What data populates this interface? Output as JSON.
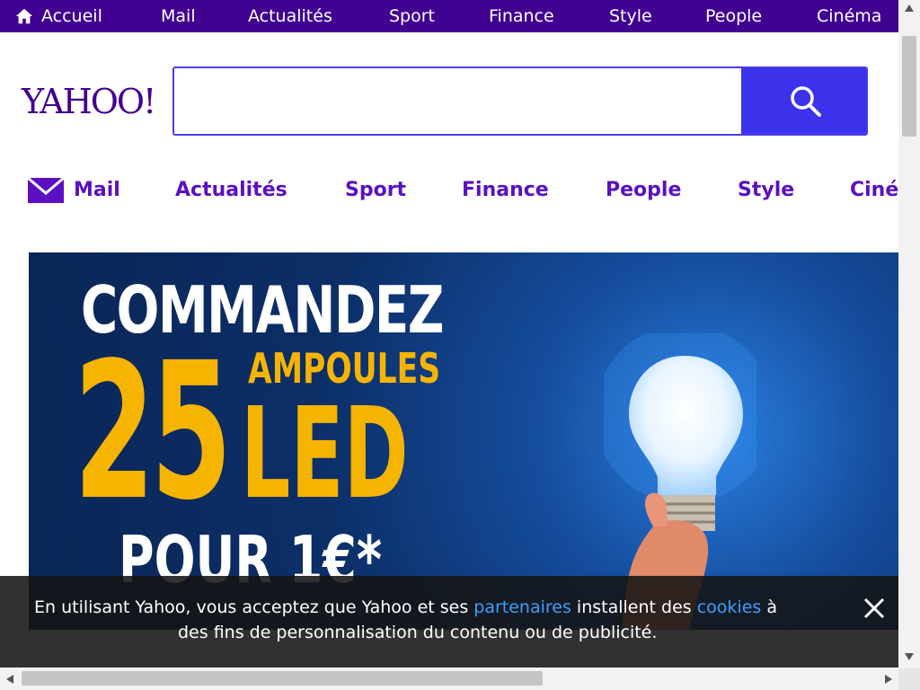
{
  "topnav": {
    "items": [
      "Accueil",
      "Mail",
      "Actualités",
      "Sport",
      "Finance",
      "Style",
      "People",
      "Cinéma"
    ]
  },
  "logo": {
    "text": "YAHOO!"
  },
  "search": {
    "value": "",
    "placeholder": ""
  },
  "subnav": {
    "items": [
      "Mail",
      "Actualités",
      "Sport",
      "Finance",
      "People",
      "Style",
      "Ciné"
    ]
  },
  "banner": {
    "line1": "COMMANDEZ",
    "big_number": "25",
    "ampoules": "AMPOULES",
    "led": "LED",
    "price": "POUR 1€*"
  },
  "cookie": {
    "text_before": "En utilisant Yahoo, vous acceptez que Yahoo et ses ",
    "link1": "partenaires",
    "text_middle": " installent des ",
    "link2": "cookies",
    "text_after": " à",
    "line2": "des fins de personnalisation du contenu ou de publicité."
  },
  "colors": {
    "brand_purple": "#400090",
    "search_blue": "#3d32ec",
    "nav_purple": "#5a10c0",
    "ad_yellow": "#f5b400"
  }
}
